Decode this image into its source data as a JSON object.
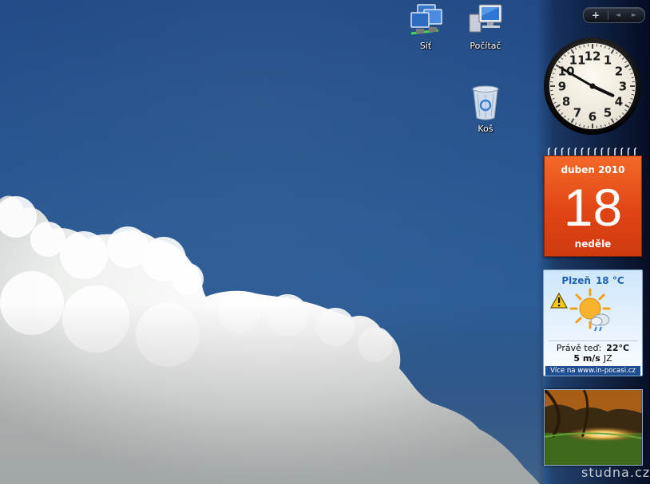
{
  "desktop": {
    "icons": [
      {
        "label": "Síť",
        "icon": "network-icon"
      },
      {
        "label": "Počítač",
        "icon": "computer-icon"
      },
      {
        "label": "Koš",
        "icon": "recycle-bin-icon"
      }
    ]
  },
  "sidebar": {
    "controls": {
      "add": "+",
      "prev": "◄",
      "next": "►"
    }
  },
  "clock": {
    "numerals": [
      "12",
      "1",
      "2",
      "3",
      "4",
      "5",
      "6",
      "7",
      "8",
      "9",
      "10",
      "11"
    ],
    "hour": 3,
    "minute": 50,
    "second": 0
  },
  "calendar": {
    "month": "duben 2010",
    "day": "18",
    "weekday": "neděle",
    "color": "#e14414"
  },
  "weather": {
    "city": "Plzeň",
    "temp": "18 °C",
    "now_label": "Právě teď:",
    "now_temp": "22°C",
    "wind_speed": "5 m/s",
    "wind_dir": "JZ",
    "footer": "Více na www.in-pocasi.cz",
    "warning_icon": "warning-icon",
    "condition_icon": "sun-cloud-rain-icon"
  },
  "watermark": "studna.cz"
}
